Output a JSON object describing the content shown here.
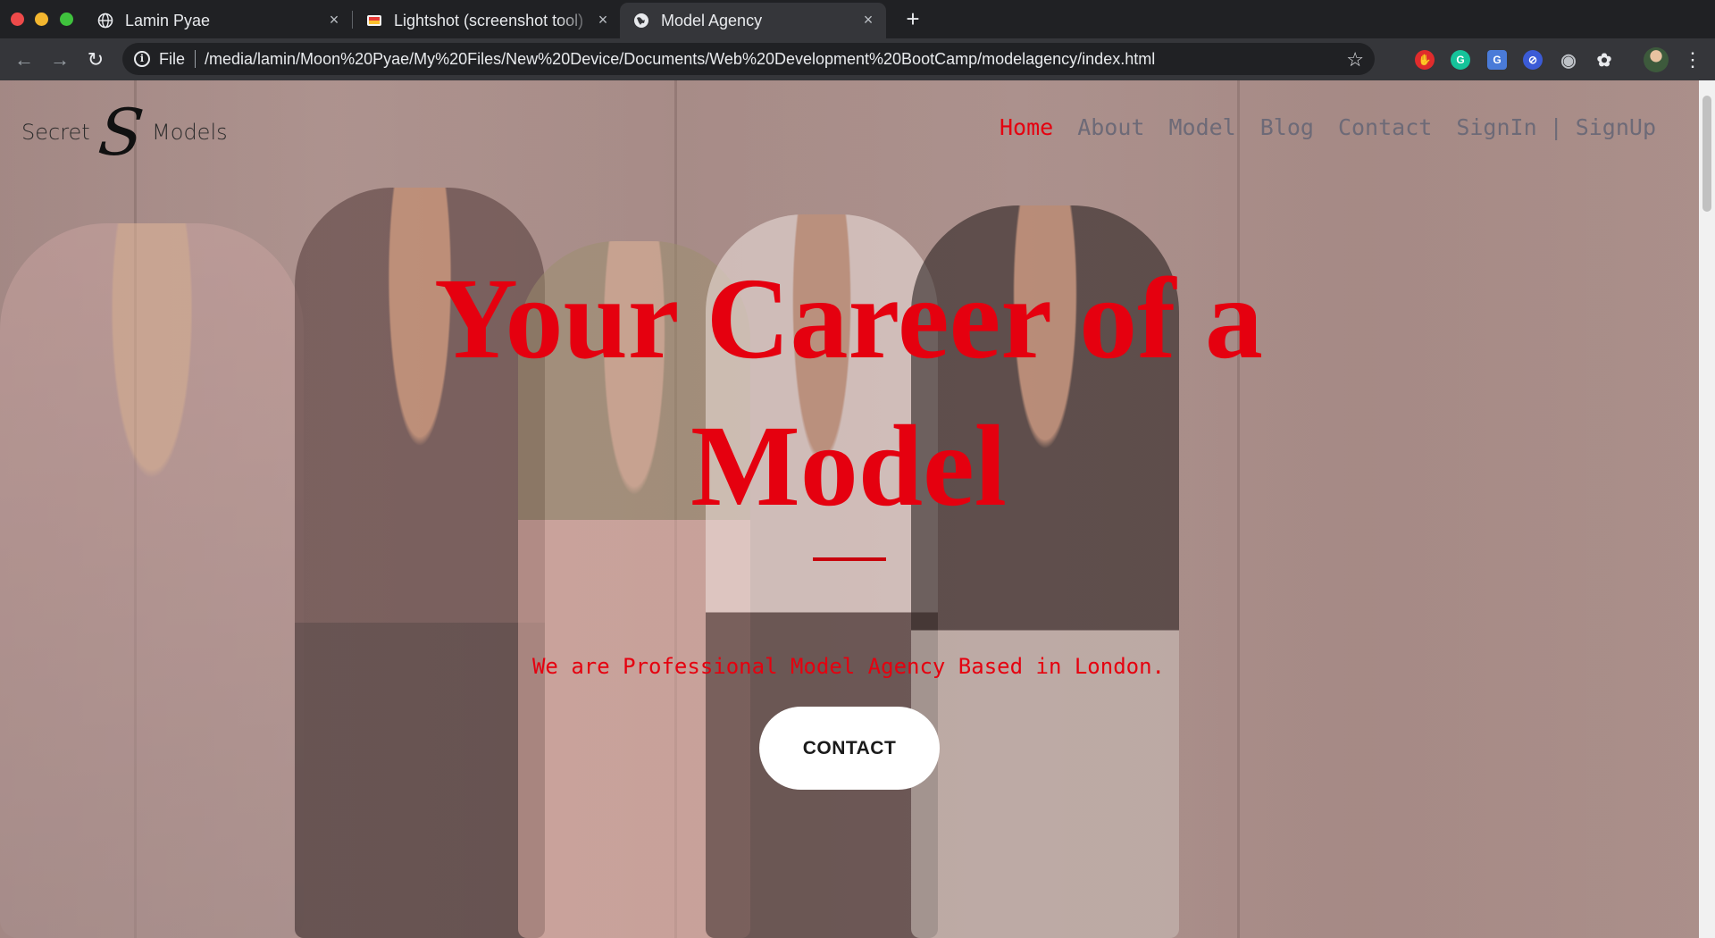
{
  "browser": {
    "tabs": [
      {
        "title": "Lamin Pyae",
        "icon": "globe-icon"
      },
      {
        "title": "Lightshot (screenshot tool)",
        "icon": "lightshot-icon"
      },
      {
        "title": "Model Agency",
        "icon": "globe-icon",
        "active": true
      }
    ],
    "new_tab_label": "+",
    "close_glyph": "×",
    "omnibox": {
      "scheme": "File",
      "url": "/media/lamin/Moon%20Pyae/My%20Files/New%20Device/Documents/Web%20Development%20BootCamp/modelagency/index.html"
    },
    "extensions": [
      "hand-stop-icon",
      "grammarly-icon",
      "translate-icon",
      "block-icon",
      "camera-icon",
      "ninja-icon"
    ]
  },
  "site": {
    "logo": {
      "left": "Secret",
      "mark": "S",
      "right": "Models"
    },
    "nav": {
      "items": [
        "Home",
        "About",
        "Model",
        "Blog",
        "Contact",
        "SignIn"
      ],
      "divider": "|",
      "signup": "SignUp",
      "active": "Home"
    },
    "hero": {
      "headline_line1": "Your Career of a",
      "headline_line2": "Model",
      "tagline": "We are Professional Model Agency Based in London.",
      "cta": "CONTACT"
    }
  },
  "colors": {
    "accent": "#e5000f",
    "nav_text": "#6d6a77",
    "chrome_dark": "#202124",
    "chrome_toolbar": "#35363a"
  }
}
